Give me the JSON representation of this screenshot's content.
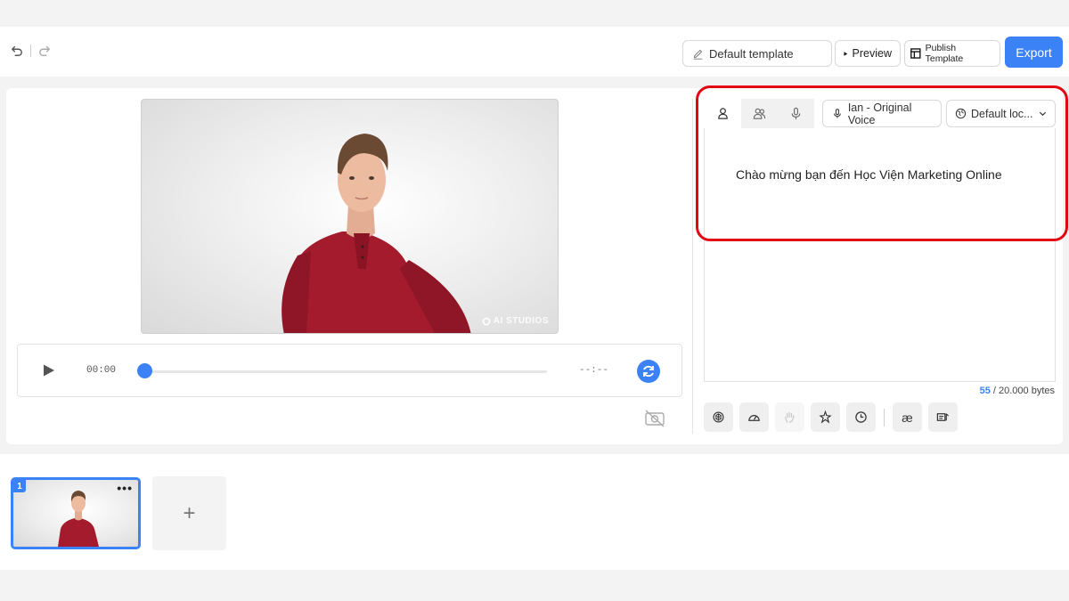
{
  "toolbar": {
    "template_name": "Default template",
    "preview_label": "Preview",
    "publish_label": "Publish Template",
    "export_label": "Export"
  },
  "video": {
    "watermark": "AI STUDIOS"
  },
  "player": {
    "current_time": "00:00",
    "end_time": "--:--",
    "progress": 0
  },
  "script_panel": {
    "voice_label": "Ian - Original Voice",
    "locale_label": "Default loc...",
    "script_text": "Chào mừng bạn đến Học Viện Marketing Online",
    "bytes_used": "55",
    "bytes_total": " / 20.000 bytes"
  },
  "tools": {
    "ae_label": "æ"
  },
  "scenes": {
    "items": [
      {
        "number": "1",
        "more": "•••"
      }
    ],
    "add_label": "+"
  },
  "colors": {
    "accent": "#3b82f6",
    "highlight": "#e30613",
    "presenter_shirt": "#a31b2c"
  }
}
